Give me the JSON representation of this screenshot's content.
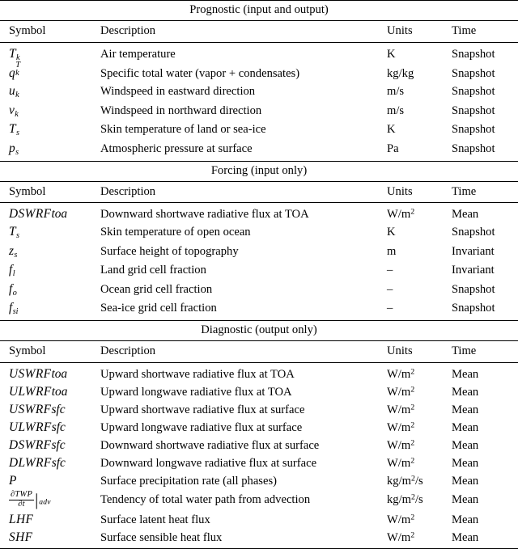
{
  "document": {
    "type": "scientific-variable-table",
    "column_headers": [
      "Symbol",
      "Description",
      "Units",
      "Time"
    ]
  },
  "sections": [
    {
      "title": "Prognostic (input and output)",
      "headers": {
        "symbol": "Symbol",
        "description": "Description",
        "units": "Units",
        "time": "Time"
      },
      "rows": [
        {
          "symbol_text": "T_k",
          "description": "Air temperature",
          "units": "K",
          "time": "Snapshot"
        },
        {
          "symbol_text": "q_k^T",
          "description": "Specific total water (vapor + condensates)",
          "units": "kg/kg",
          "time": "Snapshot"
        },
        {
          "symbol_text": "u_k",
          "description": "Windspeed in eastward direction",
          "units": "m/s",
          "time": "Snapshot"
        },
        {
          "symbol_text": "v_k",
          "description": "Windspeed in northward direction",
          "units": "m/s",
          "time": "Snapshot"
        },
        {
          "symbol_text": "T_s",
          "description": "Skin temperature of land or sea-ice",
          "units": "K",
          "time": "Snapshot"
        },
        {
          "symbol_text": "p_s",
          "description": "Atmospheric pressure at surface",
          "units": "Pa",
          "time": "Snapshot"
        }
      ]
    },
    {
      "title": "Forcing (input only)",
      "headers": {
        "symbol": "Symbol",
        "description": "Description",
        "units": "Units",
        "time": "Time"
      },
      "rows": [
        {
          "symbol_text": "DSWRFtoa",
          "description": "Downward shortwave radiative flux at TOA",
          "units": "W/m2",
          "time": "Mean"
        },
        {
          "symbol_text": "T_s",
          "description": "Skin temperature of open ocean",
          "units": "K",
          "time": "Snapshot"
        },
        {
          "symbol_text": "z_s",
          "description": "Surface height of topography",
          "units": "m",
          "time": "Invariant"
        },
        {
          "symbol_text": "f_l",
          "description": "Land grid cell fraction",
          "units": "–",
          "time": "Invariant"
        },
        {
          "symbol_text": "f_o",
          "description": "Ocean grid cell fraction",
          "units": "–",
          "time": "Snapshot"
        },
        {
          "symbol_text": "f_si",
          "description": "Sea-ice grid cell fraction",
          "units": "–",
          "time": "Snapshot"
        }
      ]
    },
    {
      "title": "Diagnostic (output only)",
      "headers": {
        "symbol": "Symbol",
        "description": "Description",
        "units": "Units",
        "time": "Time"
      },
      "rows": [
        {
          "symbol_text": "USWRFtoa",
          "description": "Upward shortwave radiative flux at TOA",
          "units": "W/m2",
          "time": "Mean"
        },
        {
          "symbol_text": "ULWRFtoa",
          "description": "Upward longwave radiative flux at TOA",
          "units": "W/m2",
          "time": "Mean"
        },
        {
          "symbol_text": "USWRFsfc",
          "description": "Upward shortwave radiative flux at surface",
          "units": "W/m2",
          "time": "Mean"
        },
        {
          "symbol_text": "ULWRFsfc",
          "description": "Upward longwave radiative flux at surface",
          "units": "W/m2",
          "time": "Mean"
        },
        {
          "symbol_text": "DSWRFsfc",
          "description": "Downward shortwave radiative flux at surface",
          "units": "W/m2",
          "time": "Mean"
        },
        {
          "symbol_text": "DLWRFsfc",
          "description": "Downward longwave radiative flux at surface",
          "units": "W/m2",
          "time": "Mean"
        },
        {
          "symbol_text": "P",
          "description": "Surface precipitation rate (all phases)",
          "units": "kg/m2/s",
          "time": "Mean"
        },
        {
          "symbol_text": "dTWP/dt|adv",
          "description": "Tendency of total water path from advection",
          "units": "kg/m2/s",
          "time": "Mean"
        },
        {
          "symbol_text": "LHF",
          "description": "Surface latent heat flux",
          "units": "W/m2",
          "time": "Mean"
        },
        {
          "symbol_text": "SHF",
          "description": "Surface sensible heat flux",
          "units": "W/m2",
          "time": "Mean"
        }
      ]
    }
  ],
  "symbol_glyphs": {
    "T_k": {
      "base": "T",
      "sub": "k"
    },
    "q_k^T": {
      "base": "q",
      "sub": "k",
      "sup": "T"
    },
    "u_k": {
      "base": "u",
      "sub": "k"
    },
    "v_k": {
      "base": "v",
      "sub": "k"
    },
    "T_s": {
      "base": "T",
      "sub": "s"
    },
    "p_s": {
      "base": "p",
      "sub": "s"
    },
    "z_s": {
      "base": "z",
      "sub": "s"
    },
    "f_l": {
      "base": "f",
      "sub": "l"
    },
    "f_o": {
      "base": "f",
      "sub": "o"
    },
    "f_si": {
      "base": "f",
      "sub": "si"
    },
    "DSWRFtoa": {
      "base": "DSWRF",
      "tail": "toa"
    },
    "USWRFtoa": {
      "base": "USWRF",
      "tail": "toa"
    },
    "ULWRFtoa": {
      "base": "ULWRF",
      "tail": "toa"
    },
    "USWRFsfc": {
      "base": "USWRF",
      "tail": "sfc"
    },
    "ULWRFsfc": {
      "base": "ULWRF",
      "tail": "sfc"
    },
    "DSWRFsfc": {
      "base": "DSWRF",
      "tail": "sfc"
    },
    "DLWRFsfc": {
      "base": "DLWRF",
      "tail": "sfc"
    },
    "P": {
      "base": "P"
    },
    "LHF": {
      "base": "LHF"
    },
    "SHF": {
      "base": "SHF"
    },
    "dTWP/dt|adv": {
      "numerator": "∂TWP",
      "denominator": "∂t",
      "evaluated_at": "adv"
    }
  },
  "units_glyphs": {
    "W/m2": {
      "text": "W/m",
      "sup": "2"
    },
    "kg/m2/s": {
      "text": "kg/m",
      "sup": "2",
      "suffix": "/s"
    },
    "kg/kg": {
      "text": "kg/kg"
    },
    "m/s": {
      "text": "m/s"
    },
    "K": {
      "text": "K"
    },
    "Pa": {
      "text": "Pa"
    },
    "m": {
      "text": "m"
    },
    "–": {
      "text": "–"
    }
  }
}
